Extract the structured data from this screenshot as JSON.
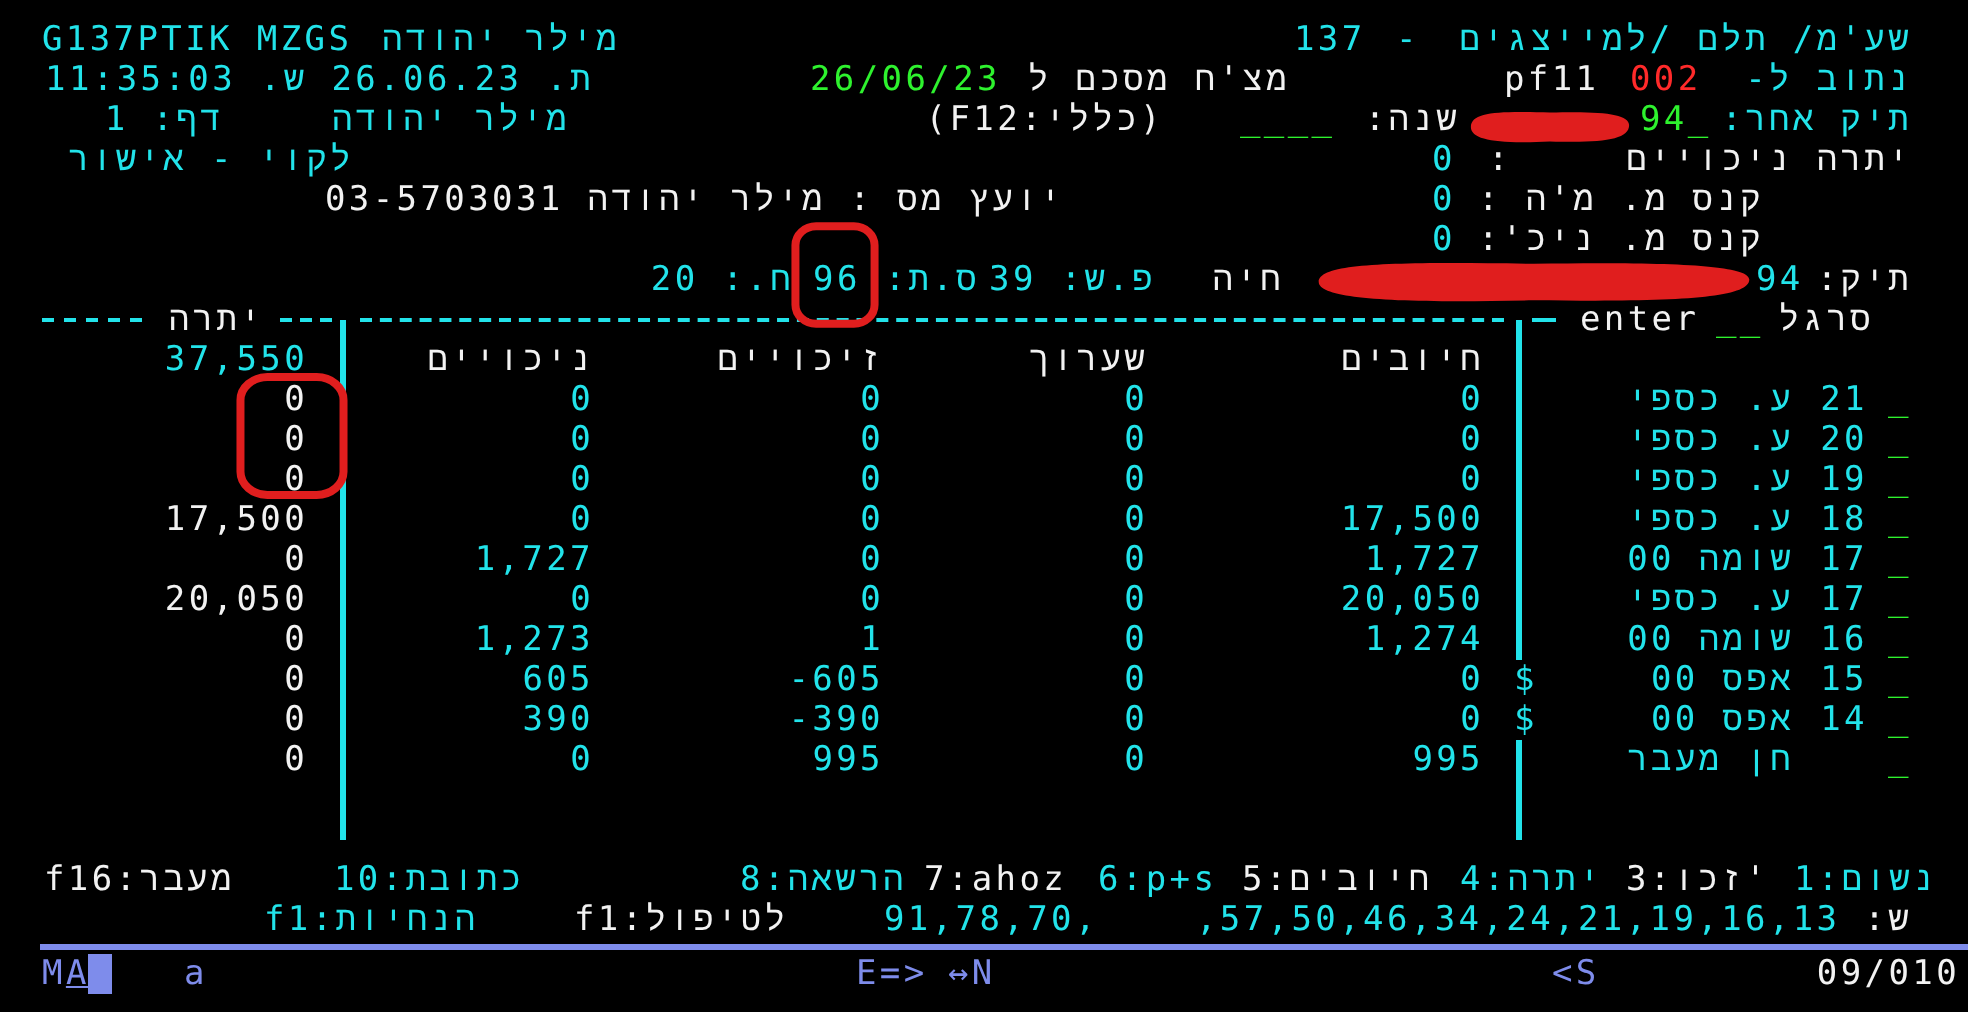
{
  "header_lines": [
    [
      {
        "text": "שע'מ/ תלם /למייצגים",
        "color": "#22e3ea"
      },
      {
        "text": "-",
        "color": "#22e3ea"
      },
      {
        "text": "137",
        "color": "#22e3ea"
      },
      {
        "text": "מילר יהודה",
        "color": "#22e3ea"
      },
      {
        "text": "G137PTIK MZGS",
        "color": "#22e3ea"
      }
    ],
    [
      {
        "text": "נתוב ל-",
        "color": "#22e3ea"
      },
      {
        "text": "002",
        "color": "#ff2a2a"
      },
      {
        "text": "pf11",
        "color": "#f2f2f2"
      },
      {
        "text": "מצ'ח מסכם ל",
        "color": "#f2f2f2"
      },
      {
        "text": "26/06/23",
        "color": "#2ef22e"
      },
      {
        "text": "ת. 26.06.23 ש. 11:35:03",
        "color": "#22e3ea"
      }
    ],
    [
      {
        "text": "תיק אחר:",
        "color": "#22e3ea"
      },
      {
        "text": "94_",
        "color": "#2ef22e"
      },
      {
        "text": "שנה:",
        "color": "#f2f2f2"
      },
      {
        "text": "____",
        "color": "#2ef22e"
      },
      {
        "text": "(כללי:F12)",
        "color": "#f2f2f2"
      },
      {
        "text": "מילר יהודה",
        "color": "#22e3ea"
      },
      {
        "text": "דף: 1",
        "color": "#22e3ea"
      }
    ],
    [
      {
        "text": "יתרה  ניכויים",
        "color": "#f2f2f2"
      },
      {
        "text": ":",
        "color": "#f2f2f2"
      },
      {
        "text": "0",
        "color": "#22e3ea"
      },
      {
        "text": "לקוי - אישור",
        "color": "#22e3ea"
      }
    ],
    [
      {
        "text": "קנס מ. מ'ה :",
        "color": "#f2f2f2"
      },
      {
        "text": "0",
        "color": "#22e3ea"
      },
      {
        "text": "יועץ מס : מילר יהודה  03-5703031",
        "color": "#f2f2f2"
      }
    ],
    [
      {
        "text": "קנס מ. ניכ':",
        "color": "#f2f2f2"
      },
      {
        "text": "0",
        "color": "#22e3ea"
      }
    ],
    [
      {
        "text": "תיק:",
        "color": "#f2f2f2"
      },
      {
        "text": "94",
        "color": "#22e3ea"
      },
      {
        "text": "חיה",
        "color": "#f2f2f2"
      },
      {
        "text": "פ.ש: 39",
        "color": "#22e3ea"
      },
      {
        "text": "ס.ת: 96",
        "color": "#22e3ea"
      },
      {
        "text": "ח.: 20",
        "color": "#22e3ea"
      }
    ]
  ],
  "ledger": {
    "balance_label": "יתרה",
    "command": "enter",
    "command_field": "__",
    "ruler_label": "סרגל",
    "total_balance": "37,550",
    "columns": [
      "חיובים",
      "שערוך",
      "זיכויים",
      "ניכויים"
    ],
    "rows": [
      {
        "input": "_",
        "number": "21",
        "name": "ע. כספי",
        "values": [
          "0",
          "0",
          "0",
          "0"
        ],
        "balance": "0"
      },
      {
        "input": "_",
        "number": "20",
        "name": "ע. כספי",
        "values": [
          "0",
          "0",
          "0",
          "0"
        ],
        "balance": "0"
      },
      {
        "input": "_",
        "number": "19",
        "name": "ע. כספי",
        "values": [
          "0",
          "0",
          "0",
          "0"
        ],
        "balance": "0"
      },
      {
        "input": "_",
        "number": "18",
        "name": "ע. כספי",
        "values": [
          "17,500",
          "0",
          "0",
          "0"
        ],
        "balance": "17,500"
      },
      {
        "input": "_",
        "number": "17",
        "name": "שומה 00",
        "values": [
          "1,727",
          "0",
          "0",
          "1,727"
        ],
        "balance": "0"
      },
      {
        "input": "_",
        "number": "17",
        "name": "ע. כספי",
        "values": [
          "20,050",
          "0",
          "0",
          "0"
        ],
        "balance": "20,050"
      },
      {
        "input": "_",
        "number": "16",
        "name": "שומה 00",
        "values": [
          "1,274",
          "0",
          "1",
          "1,273"
        ],
        "balance": "0"
      },
      {
        "input": "_",
        "number": "15",
        "name": "אפס 00",
        "marker": "$",
        "values": [
          "0",
          "0",
          "-605",
          "605"
        ],
        "balance": "0"
      },
      {
        "input": "_",
        "number": "14",
        "name": "אפס 00",
        "marker": "$",
        "values": [
          "0",
          "0",
          "-390",
          "390"
        ],
        "balance": "0"
      },
      {
        "input": "_",
        "name": "חן מעבר",
        "values": [
          "995",
          "0",
          "995",
          "0"
        ],
        "balance": "0"
      }
    ]
  },
  "function_keys": [
    {
      "text": "1:נשום",
      "color": "#22e3ea"
    },
    {
      "text": "3:זכו'",
      "color": "#f2f2f2"
    },
    {
      "text": "4:יתרה",
      "color": "#22e3ea"
    },
    {
      "text": "5:חיובים",
      "color": "#f2f2f2"
    },
    {
      "text": "6:p+s",
      "color": "#22e3ea"
    },
    {
      "text": "7:ahoz",
      "color": "#f2f2f2"
    },
    {
      "text": "8:הרשאה",
      "color": "#22e3ea"
    },
    {
      "text": "10:כתובת",
      "color": "#22e3ea"
    },
    {
      "text": "f16:מעבר",
      "color": "#f2f2f2"
    }
  ],
  "hints": [
    {
      "text": "ש:",
      "color": "#f2f2f2"
    },
    {
      "text": ",57,50,46,34,24,21,19,16,13",
      "color": "#22e3ea"
    },
    {
      "text": "91,78,70,",
      "color": "#22e3ea"
    },
    {
      "text": "f1:לטיפול",
      "color": "#f2f2f2"
    },
    {
      "text": "f1:הנחיות",
      "color": "#22e3ea"
    }
  ],
  "status_bar": {
    "mode": "MA",
    "field": "a",
    "insert": "E=>",
    "direction": "↔N",
    "shift": "<S",
    "position": "09/010"
  },
  "annotations": [
    {
      "kind": "circle"
    },
    {
      "kind": "circle"
    },
    {
      "kind": "scribble"
    },
    {
      "kind": "scribble"
    }
  ]
}
